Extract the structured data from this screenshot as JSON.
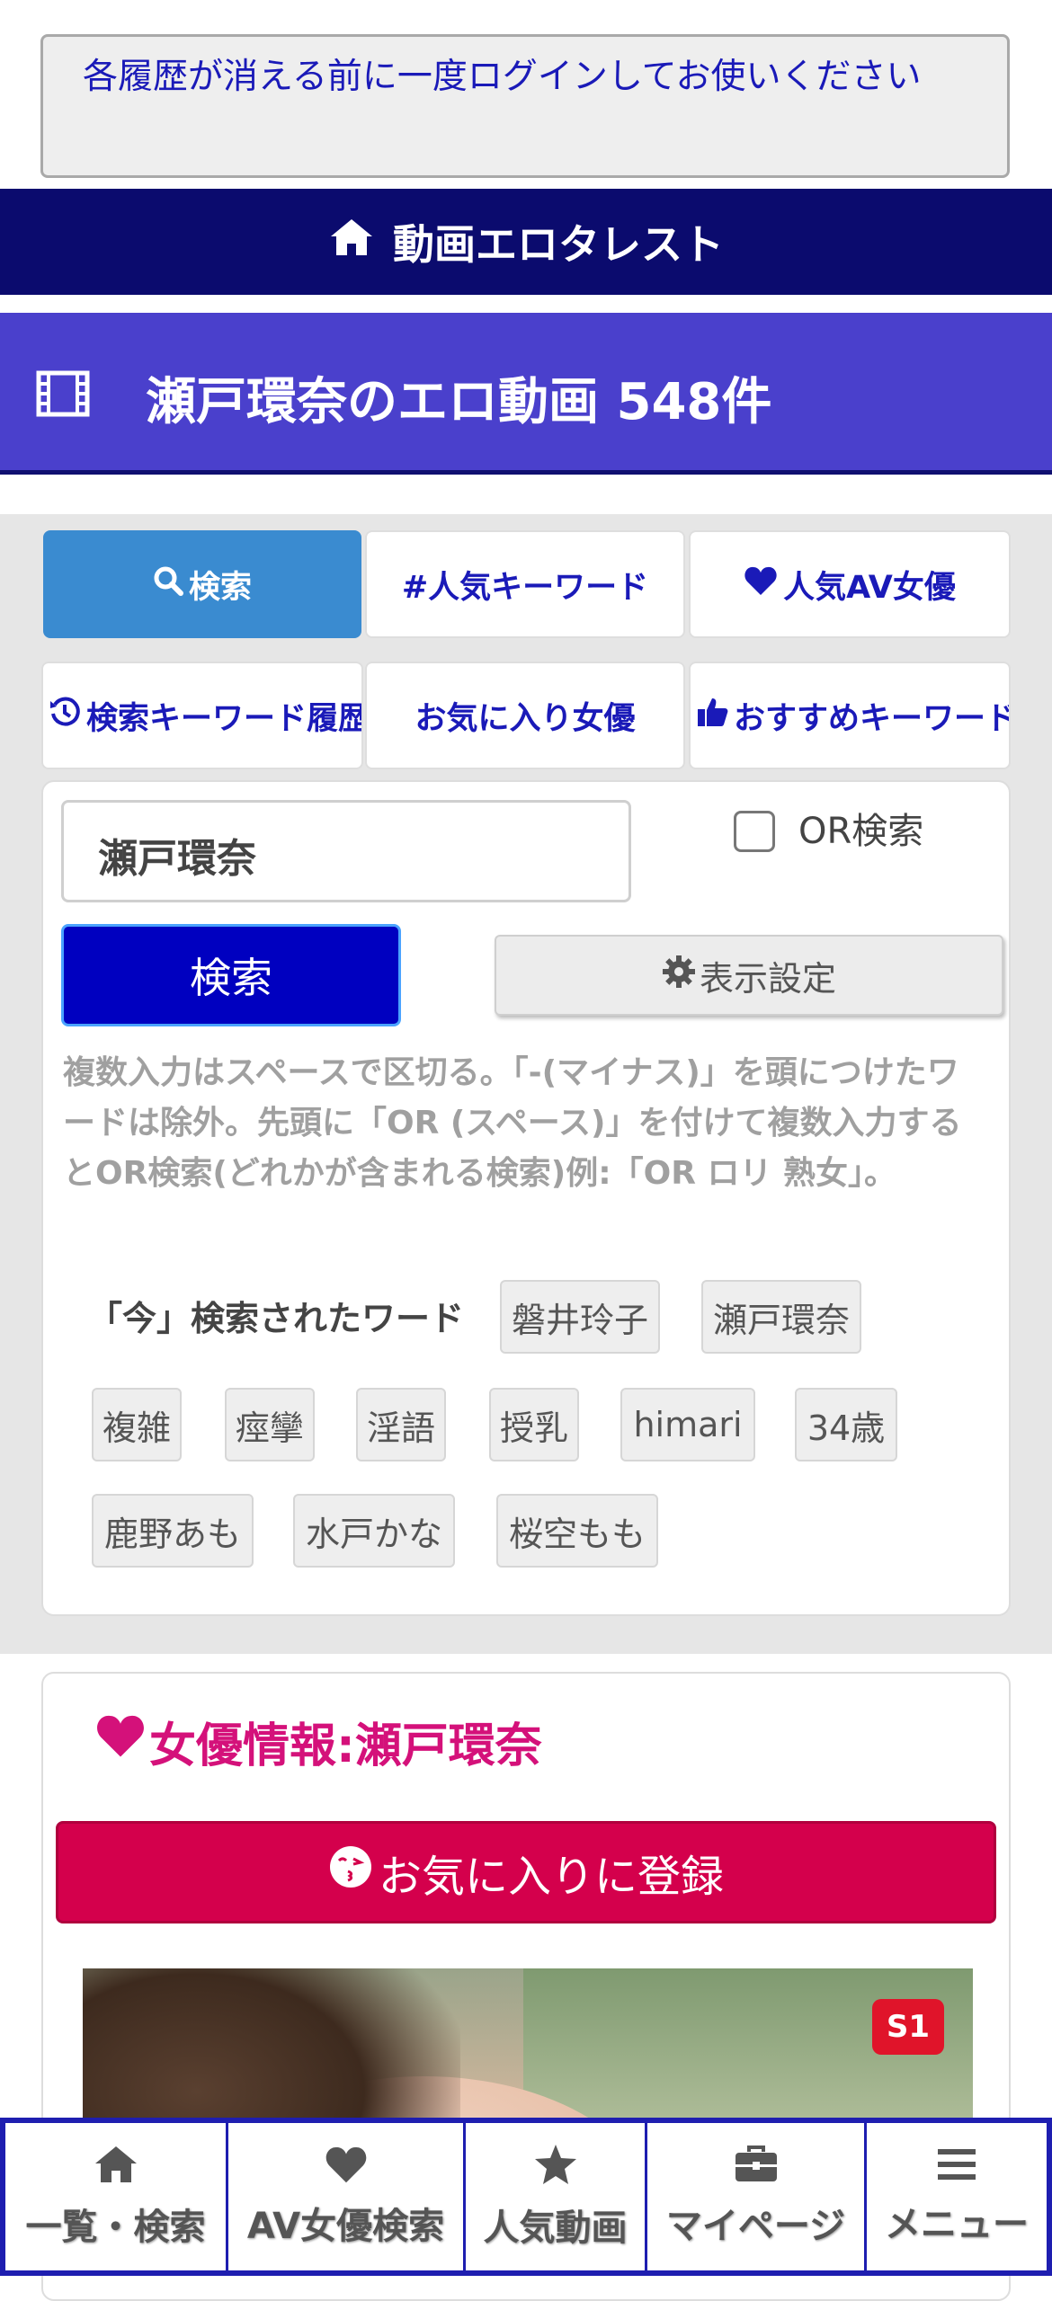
{
  "notice": "各履歴が消える前に一度ログインしてお使いください",
  "topbar": {
    "title": "動画エロタレスト"
  },
  "page_title": "瀬戸環奈のエロ動画 548件",
  "tabs": [
    {
      "label": "検索",
      "icon": "search-icon"
    },
    {
      "label": "#人気キーワード",
      "icon": ""
    },
    {
      "label": "人気AV女優",
      "icon": "heart-icon"
    },
    {
      "label": "検索キーワード履歴",
      "icon": "history-icon"
    },
    {
      "label": "お気に入り女優",
      "icon": ""
    },
    {
      "label": "おすすめキーワード",
      "icon": "thumbs-up-icon"
    }
  ],
  "search": {
    "value": "瀬戸環奈",
    "or_label": "OR検索",
    "button": "検索",
    "display_settings": "表示設定",
    "help": "複数入力はスペースで区切る。「-(マイナス)」を頭につけたワードは除外。先頭に「OR (スペース)」を付けて複数入力するとOR検索(どれかが含まれる検索)例:「OR ロリ 熟女」。"
  },
  "now_searched": {
    "label": "「今」検索されたワード",
    "words": [
      "磐井玲子",
      "瀬戸環奈",
      "複雑",
      "痙攣",
      "淫語",
      "授乳",
      "himari",
      "34歳",
      "鹿野あも",
      "水戸かな",
      "桜空もも"
    ]
  },
  "actress": {
    "title": "女優情報:瀬戸環奈",
    "favorite_button": "お気に入りに登録",
    "badge": "S1"
  },
  "bottom_nav": [
    {
      "label": "一覧・検索",
      "icon": "home-icon"
    },
    {
      "label": "AV女優検索",
      "icon": "heart-icon"
    },
    {
      "label": "人気動画",
      "icon": "star-icon"
    },
    {
      "label": "マイページ",
      "icon": "briefcase-icon"
    },
    {
      "label": "メニュー",
      "icon": "menu-icon"
    }
  ],
  "colors": {
    "header_navy": "#0b0b6e",
    "title_purple": "#4a40cc",
    "active_tab": "#3a8bd0",
    "link_blue": "#1a1ab8",
    "search_button": "#0000c0",
    "actress_pink": "#d4117a",
    "favorite_red": "#d4004c"
  }
}
